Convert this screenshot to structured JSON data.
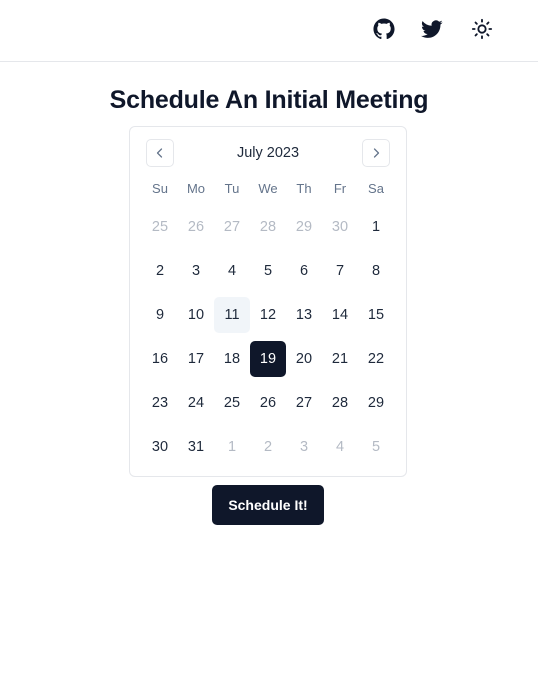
{
  "header": {
    "icons": [
      "github-icon",
      "twitter-icon",
      "sun-icon"
    ]
  },
  "page": {
    "title": "Schedule An Initial Meeting"
  },
  "calendar": {
    "month_label": "July 2023",
    "weekdays": [
      "Su",
      "Mo",
      "Tu",
      "We",
      "Th",
      "Fr",
      "Sa"
    ],
    "today": 11,
    "selected": 19,
    "weeks": [
      [
        {
          "d": "25",
          "out": true
        },
        {
          "d": "26",
          "out": true
        },
        {
          "d": "27",
          "out": true
        },
        {
          "d": "28",
          "out": true
        },
        {
          "d": "29",
          "out": true
        },
        {
          "d": "30",
          "out": true
        },
        {
          "d": "1",
          "out": false
        }
      ],
      [
        {
          "d": "2",
          "out": false
        },
        {
          "d": "3",
          "out": false
        },
        {
          "d": "4",
          "out": false
        },
        {
          "d": "5",
          "out": false
        },
        {
          "d": "6",
          "out": false
        },
        {
          "d": "7",
          "out": false
        },
        {
          "d": "8",
          "out": false
        }
      ],
      [
        {
          "d": "9",
          "out": false
        },
        {
          "d": "10",
          "out": false
        },
        {
          "d": "11",
          "out": false
        },
        {
          "d": "12",
          "out": false
        },
        {
          "d": "13",
          "out": false
        },
        {
          "d": "14",
          "out": false
        },
        {
          "d": "15",
          "out": false
        }
      ],
      [
        {
          "d": "16",
          "out": false
        },
        {
          "d": "17",
          "out": false
        },
        {
          "d": "18",
          "out": false
        },
        {
          "d": "19",
          "out": false
        },
        {
          "d": "20",
          "out": false
        },
        {
          "d": "21",
          "out": false
        },
        {
          "d": "22",
          "out": false
        }
      ],
      [
        {
          "d": "23",
          "out": false
        },
        {
          "d": "24",
          "out": false
        },
        {
          "d": "25",
          "out": false
        },
        {
          "d": "26",
          "out": false
        },
        {
          "d": "27",
          "out": false
        },
        {
          "d": "28",
          "out": false
        },
        {
          "d": "29",
          "out": false
        }
      ],
      [
        {
          "d": "30",
          "out": false
        },
        {
          "d": "31",
          "out": false
        },
        {
          "d": "1",
          "out": true
        },
        {
          "d": "2",
          "out": true
        },
        {
          "d": "3",
          "out": true
        },
        {
          "d": "4",
          "out": true
        },
        {
          "d": "5",
          "out": true
        }
      ]
    ]
  },
  "actions": {
    "schedule_label": "Schedule It!"
  },
  "colors": {
    "primary": "#0f172a",
    "today_bg": "#f1f5f9",
    "muted_text": "#b4bac4",
    "border": "#e5e7eb"
  }
}
